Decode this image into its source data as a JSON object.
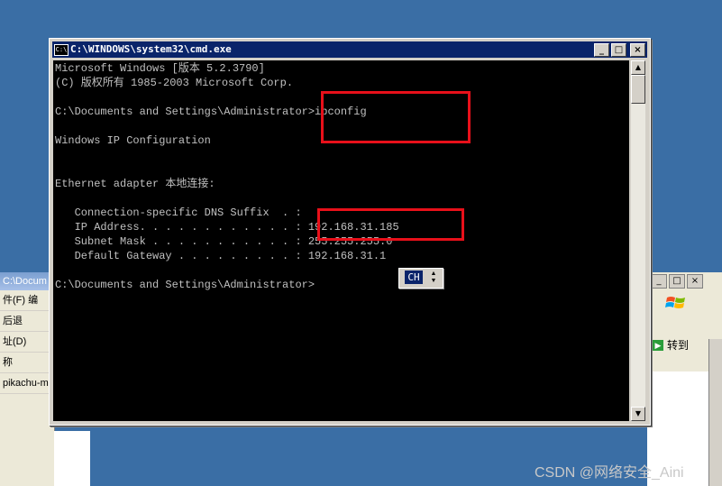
{
  "background_left": {
    "title": "C:\\Docum",
    "menu": "件(F)  编",
    "back": "后退",
    "address_label": "址(D)",
    "column": "称",
    "item": "pikachu-m"
  },
  "background_right": {
    "go_label": "转到"
  },
  "cmd": {
    "title": "C:\\WINDOWS\\system32\\cmd.exe",
    "icon_text": "C:\\",
    "buttons": {
      "minimize": "_",
      "maximize": "□",
      "close": "×"
    },
    "lines": [
      "Microsoft Windows [版本 5.2.3790]",
      "(C) 版权所有 1985-2003 Microsoft Corp.",
      "",
      "C:\\Documents and Settings\\Administrator>ipconfig",
      "",
      "Windows IP Configuration",
      "",
      "",
      "Ethernet adapter 本地连接:",
      "",
      "   Connection-specific DNS Suffix  . :",
      "   IP Address. . . . . . . . . . . . : 192.168.31.185",
      "   Subnet Mask . . . . . . . . . . . : 255.255.255.0",
      "   Default Gateway . . . . . . . . . : 192.168.31.1",
      "",
      "C:\\Documents and Settings\\Administrator>"
    ]
  },
  "ime": {
    "label": "CH"
  },
  "watermark": "CSDN @网络安全_Aini",
  "colors": {
    "highlight": "#e8101a",
    "titlebar": "#0a246a",
    "desktop": "#3a6ea5"
  }
}
